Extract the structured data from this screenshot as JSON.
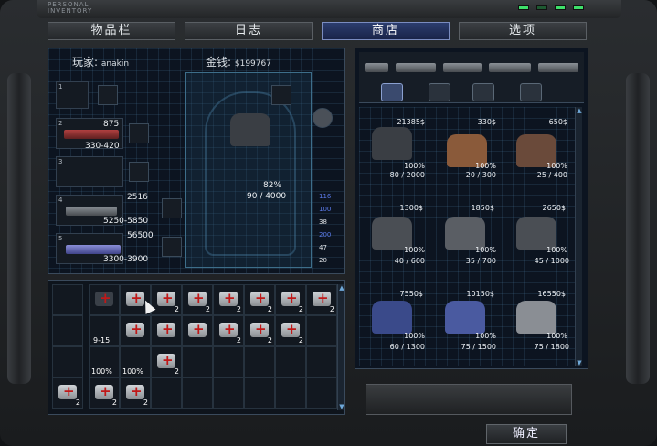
{
  "brand": {
    "line1": "PERSONAL",
    "line2": "INVENTORY"
  },
  "tabs": [
    "物品栏",
    "日志",
    "商店",
    "选项"
  ],
  "active_tab": 2,
  "player": {
    "label": "玩家:",
    "name": "anakin"
  },
  "gold": {
    "label": "金钱:",
    "amount": "$199767"
  },
  "slots": {
    "s1": "1",
    "s2": {
      "num": "2",
      "ammo": "875",
      "range": "330-420"
    },
    "s3": "3",
    "s4": {
      "num": "4",
      "ammo": "2516",
      "range": "5250-5850"
    },
    "s5": {
      "num": "5",
      "ammo": "56500",
      "range": "3300-3900"
    }
  },
  "armor_equipped": {
    "condition": "82%",
    "durability": "90 / 4000"
  },
  "ammo_counts": [
    "116",
    "100",
    "38",
    "200",
    "47",
    "20"
  ],
  "inventory": {
    "row1": [
      {
        "qty": ""
      },
      {
        "qty": "2"
      },
      {
        "qty": "2"
      },
      {
        "qty": "2"
      },
      {
        "qty": "2"
      },
      {
        "qty": "2"
      },
      {
        "qty": "2"
      }
    ],
    "row2": [
      {
        "label": "9-15"
      },
      {
        "qty": ""
      },
      {
        "qty": ""
      },
      {
        "qty": ""
      },
      {
        "qty": "2"
      },
      {
        "qty": "2"
      },
      {
        "qty": "2"
      }
    ],
    "row3": [
      {
        "pct": "100%"
      },
      {
        "pct": "100%"
      },
      {
        "qty": "2"
      }
    ],
    "row4": [
      {
        "qty": "2"
      },
      {
        "qty": "2"
      },
      {
        "qty": "2"
      }
    ]
  },
  "shop_items": [
    {
      "price": "21385$",
      "pct": "100%",
      "dur": "80 / 2000",
      "color": "#3a3e44"
    },
    {
      "price": "330$",
      "pct": "100%",
      "dur": "20 / 300",
      "color": "#8a5a3a"
    },
    {
      "price": "650$",
      "pct": "100%",
      "dur": "25 / 400",
      "color": "#6a4a3a"
    },
    {
      "price": "1300$",
      "pct": "100%",
      "dur": "40 / 600",
      "color": "#4a4e54"
    },
    {
      "price": "1850$",
      "pct": "100%",
      "dur": "35 / 700",
      "color": "#5a5e64"
    },
    {
      "price": "2650$",
      "pct": "100%",
      "dur": "45 / 1000",
      "color": "#4a4e54"
    },
    {
      "price": "7550$",
      "pct": "100%",
      "dur": "60 / 1300",
      "color": "#3a4a8a"
    },
    {
      "price": "10150$",
      "pct": "100%",
      "dur": "75 / 1500",
      "color": "#4a5aa0"
    },
    {
      "price": "16550$",
      "pct": "100%",
      "dur": "75 / 1800",
      "color": "#8a8e94"
    }
  ],
  "confirm_label": "确定"
}
